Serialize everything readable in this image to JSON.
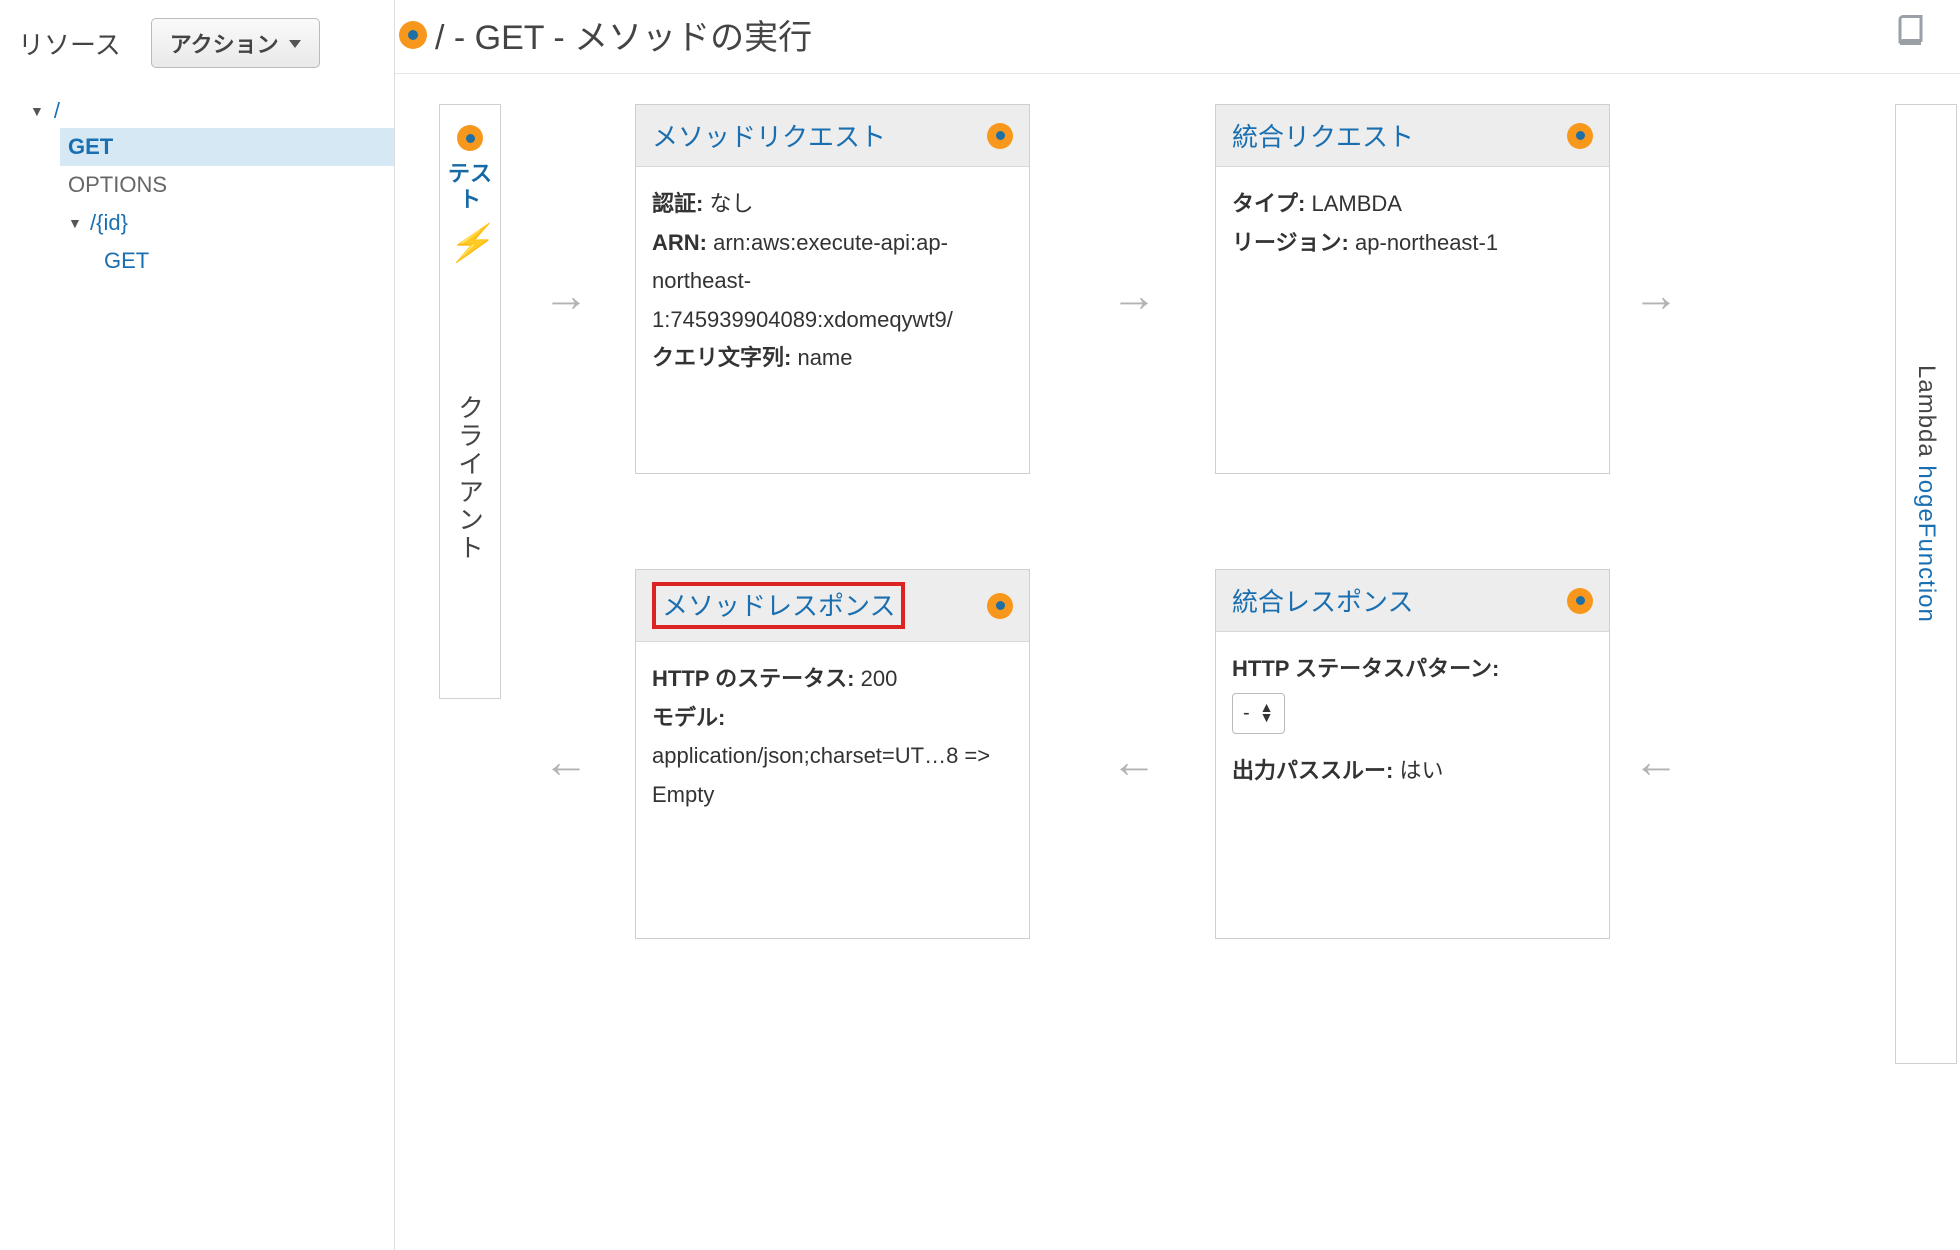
{
  "sidebar": {
    "title": "リソース",
    "actions_label": "アクション",
    "tree": {
      "root": "/",
      "items": [
        {
          "label": "GET",
          "selected": true
        },
        {
          "label": "OPTIONS",
          "selected": false
        }
      ],
      "child_path": "/{id}",
      "child_items": [
        {
          "label": "GET"
        }
      ]
    }
  },
  "header": {
    "title": "/ - GET - メソッドの実行"
  },
  "client": {
    "test_label_1": "テス",
    "test_label_2": "ト",
    "vertical": "クライアント"
  },
  "lambda": {
    "prefix": "Lambda ",
    "function": "hogeFunction"
  },
  "cards": {
    "method_request": {
      "title": "メソッドリクエスト",
      "auth_label": "認証:",
      "auth_value": "なし",
      "arn_label": "ARN:",
      "arn_value": "arn:aws:execute-api:ap-northeast-1:745939904089:xdomeqywt9/",
      "query_label": "クエリ文字列:",
      "query_value": "name"
    },
    "integration_request": {
      "title": "統合リクエスト",
      "type_label": "タイプ:",
      "type_value": "LAMBDA",
      "region_label": "リージョン:",
      "region_value": "ap-northeast-1"
    },
    "method_response": {
      "title": "メソッドレスポンス",
      "status_label": "HTTP のステータス:",
      "status_value": "200",
      "model_label": "モデル:",
      "model_value": "application/json;charset=UT…8 => Empty"
    },
    "integration_response": {
      "title": "統合レスポンス",
      "pattern_label": "HTTP ステータスパターン:",
      "pattern_value": "-",
      "passthrough_label": "出力パススルー:",
      "passthrough_value": "はい"
    }
  }
}
